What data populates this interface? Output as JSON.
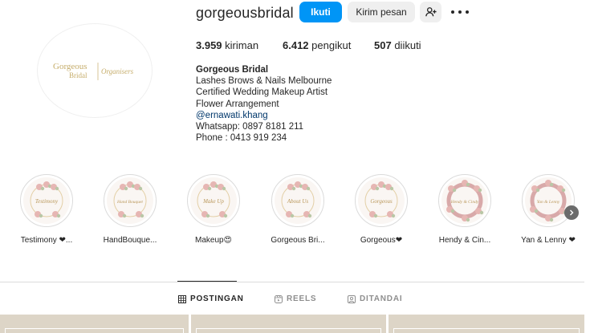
{
  "profile": {
    "username": "gorgeousbridal",
    "avatar_logo_text": "Gorgeous Bridal | Organisers"
  },
  "actions": {
    "follow_label": "Ikuti",
    "message_label": "Kirim pesan"
  },
  "stats": {
    "posts_count": "3.959",
    "posts_label": "kiriman",
    "followers_count": "6.412",
    "followers_label": "pengikut",
    "following_count": "507",
    "following_label": "diikuti"
  },
  "bio": {
    "name": "Gorgeous Bridal",
    "lines": [
      "Lashes Brows & Nails Melbourne",
      "Certified Wedding Makeup Artist",
      "Flower Arrangement"
    ],
    "mention": "@ernawati.khang",
    "whatsapp": "Whatsapp: 0897 8181 211",
    "phone": "Phone : 0413 919 234"
  },
  "highlights": [
    {
      "label": "Testimony ❤...",
      "cover_text": "Testimony"
    },
    {
      "label": "HandBouque...",
      "cover_text": "Hand Bouquet"
    },
    {
      "label": "Makeup😍",
      "cover_text": "Make Up"
    },
    {
      "label": "Gorgeous Bri...",
      "cover_text": "About Us"
    },
    {
      "label": "Gorgeous❤",
      "cover_text": "Gorgeous"
    },
    {
      "label": "Hendy & Cin...",
      "cover_text": "Hendy & Cindy"
    },
    {
      "label": "Yan & Lenny ❤",
      "cover_text": "Yan & Lenny"
    }
  ],
  "tabs": [
    {
      "label": "POSTINGAN",
      "icon": "grid-icon",
      "active": true
    },
    {
      "label": "REELS",
      "icon": "reels-icon",
      "active": false
    },
    {
      "label": "DITANDAI",
      "icon": "tagged-icon",
      "active": false
    }
  ],
  "colors": {
    "accent": "#0095f6",
    "mention": "#00376b",
    "grid_tile": "#ddd5c7"
  }
}
